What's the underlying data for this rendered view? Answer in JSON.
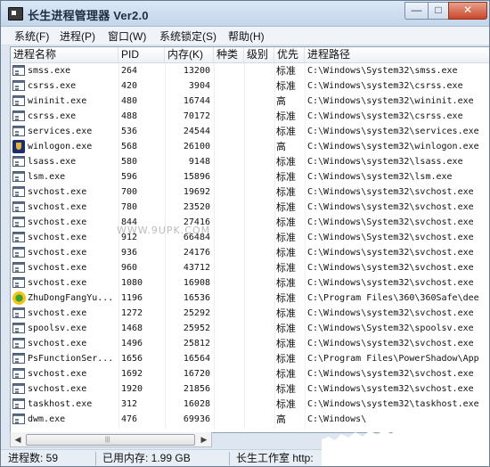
{
  "window": {
    "title": "长生进程管理器 Ver2.0",
    "controls": {
      "minimize": "—",
      "maximize": "□",
      "close": "✕"
    }
  },
  "menu": [
    "系统(F)",
    "进程(P)",
    "窗口(W)",
    "系统锁定(S)",
    "帮助(H)"
  ],
  "columns": {
    "name": "进程名称",
    "pid": "PID",
    "memory": "内存(K)",
    "type": "种类",
    "level": "级别",
    "priority": "优先",
    "path": "进程路径"
  },
  "processes": [
    {
      "icon": "window-icon",
      "name": "smss.exe",
      "pid": "264",
      "memory": "13200",
      "priority": "标准",
      "path": "C:\\Windows\\System32\\smss.exe"
    },
    {
      "icon": "window-icon",
      "name": "csrss.exe",
      "pid": "420",
      "memory": "3904",
      "priority": "标准",
      "path": "C:\\Windows\\system32\\csrss.exe"
    },
    {
      "icon": "window-icon",
      "name": "wininit.exe",
      "pid": "480",
      "memory": "16744",
      "priority": "高",
      "path": "C:\\Windows\\system32\\wininit.exe"
    },
    {
      "icon": "window-icon",
      "name": "csrss.exe",
      "pid": "488",
      "memory": "70172",
      "priority": "标准",
      "path": "C:\\Windows\\system32\\csrss.exe"
    },
    {
      "icon": "window-icon",
      "name": "services.exe",
      "pid": "536",
      "memory": "24544",
      "priority": "标准",
      "path": "C:\\Windows\\system32\\services.exe"
    },
    {
      "icon": "shield-icon",
      "name": "winlogon.exe",
      "pid": "568",
      "memory": "26100",
      "priority": "高",
      "path": "C:\\Windows\\system32\\winlogon.exe"
    },
    {
      "icon": "window-icon",
      "name": "lsass.exe",
      "pid": "580",
      "memory": "9148",
      "priority": "标准",
      "path": "C:\\Windows\\system32\\lsass.exe"
    },
    {
      "icon": "window-icon",
      "name": "lsm.exe",
      "pid": "596",
      "memory": "15896",
      "priority": "标准",
      "path": "C:\\Windows\\system32\\lsm.exe"
    },
    {
      "icon": "window-icon",
      "name": "svchost.exe",
      "pid": "700",
      "memory": "19692",
      "priority": "标准",
      "path": "C:\\Windows\\system32\\svchost.exe"
    },
    {
      "icon": "window-icon",
      "name": "svchost.exe",
      "pid": "780",
      "memory": "23520",
      "priority": "标准",
      "path": "C:\\Windows\\system32\\svchost.exe"
    },
    {
      "icon": "window-icon",
      "name": "svchost.exe",
      "pid": "844",
      "memory": "27416",
      "priority": "标准",
      "path": "C:\\Windows\\System32\\svchost.exe"
    },
    {
      "icon": "window-icon",
      "name": "svchost.exe",
      "pid": "912",
      "memory": "66484",
      "priority": "标准",
      "path": "C:\\Windows\\System32\\svchost.exe"
    },
    {
      "icon": "window-icon",
      "name": "svchost.exe",
      "pid": "936",
      "memory": "24176",
      "priority": "标准",
      "path": "C:\\Windows\\system32\\svchost.exe"
    },
    {
      "icon": "window-icon",
      "name": "svchost.exe",
      "pid": "960",
      "memory": "43712",
      "priority": "标准",
      "path": "C:\\Windows\\system32\\svchost.exe"
    },
    {
      "icon": "window-icon",
      "name": "svchost.exe",
      "pid": "1080",
      "memory": "16908",
      "priority": "标准",
      "path": "C:\\Windows\\system32\\svchost.exe"
    },
    {
      "icon": "360-icon",
      "name": "ZhuDongFangYu...",
      "pid": "1196",
      "memory": "16536",
      "priority": "标准",
      "path": "C:\\Program Files\\360\\360Safe\\dee"
    },
    {
      "icon": "window-icon",
      "name": "svchost.exe",
      "pid": "1272",
      "memory": "25292",
      "priority": "标准",
      "path": "C:\\Windows\\system32\\svchost.exe"
    },
    {
      "icon": "window-icon",
      "name": "spoolsv.exe",
      "pid": "1468",
      "memory": "25952",
      "priority": "标准",
      "path": "C:\\Windows\\System32\\spoolsv.exe"
    },
    {
      "icon": "window-icon",
      "name": "svchost.exe",
      "pid": "1496",
      "memory": "25812",
      "priority": "标准",
      "path": "C:\\Windows\\system32\\svchost.exe"
    },
    {
      "icon": "window-icon",
      "name": "PsFunctionSer...",
      "pid": "1656",
      "memory": "16564",
      "priority": "标准",
      "path": "C:\\Program Files\\PowerShadow\\App"
    },
    {
      "icon": "window-icon",
      "name": "svchost.exe",
      "pid": "1692",
      "memory": "16720",
      "priority": "标准",
      "path": "C:\\Windows\\system32\\svchost.exe"
    },
    {
      "icon": "window-icon",
      "name": "svchost.exe",
      "pid": "1920",
      "memory": "21856",
      "priority": "标准",
      "path": "C:\\Windows\\system32\\svchost.exe"
    },
    {
      "icon": "window-icon",
      "name": "taskhost.exe",
      "pid": "312",
      "memory": "16028",
      "priority": "标准",
      "path": "C:\\Windows\\system32\\taskhost.exe"
    },
    {
      "icon": "window-icon",
      "name": "dwm.exe",
      "pid": "476",
      "memory": "69936",
      "priority": "高",
      "path": "C:\\Windows\\"
    }
  ],
  "watermark": "WWW.9UPK.COM",
  "status": {
    "process_count": "进程数: 59",
    "memory_used": "已用内存: 1.99 GB",
    "studio": "长生工作室 http:"
  }
}
